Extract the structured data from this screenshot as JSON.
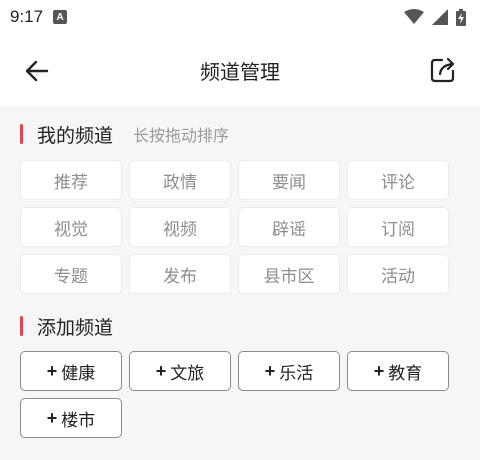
{
  "status": {
    "time": "9:17",
    "notification_glyph": "A"
  },
  "header": {
    "title": "频道管理"
  },
  "my_channels": {
    "title": "我的频道",
    "hint": "长按拖动排序",
    "items": [
      "推荐",
      "政情",
      "要闻",
      "评论",
      "视觉",
      "视频",
      "辟谣",
      "订阅",
      "专题",
      "发布",
      "县市区",
      "活动"
    ]
  },
  "add_channels": {
    "title": "添加频道",
    "plus": "+",
    "items": [
      "健康",
      "文旅",
      "乐活",
      "教育",
      "楼市"
    ]
  },
  "colors": {
    "accent": "#e5414a",
    "chip_text": "#8e8e8e",
    "background": "#f6f6f8"
  }
}
